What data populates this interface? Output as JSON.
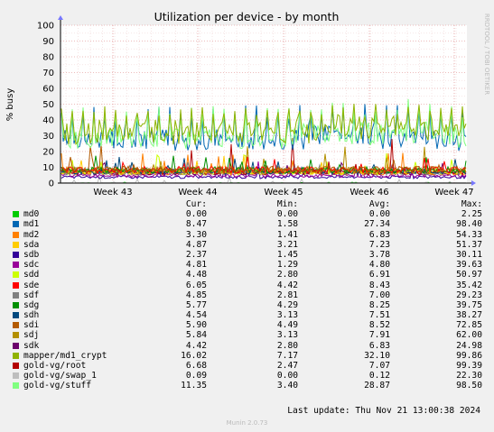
{
  "chart_data": {
    "type": "line",
    "title": "Utilization per device - by month",
    "ylabel": "% busy",
    "side_label": "RRDTOOL / TOBI OETIKER",
    "ylim": [
      0,
      100
    ],
    "y_ticks": [
      0,
      10,
      20,
      30,
      40,
      50,
      60,
      70,
      80,
      90,
      100
    ],
    "x_tick_labels": [
      "Week 43",
      "Week 44",
      "Week 45",
      "Week 46",
      "Week 47"
    ],
    "grid": true,
    "columns": {
      "cur": "Cur:",
      "min": "Min:",
      "avg": "Avg:",
      "max": "Max:"
    },
    "series": [
      {
        "name": "md0",
        "color": "#00cc00",
        "cur": "0.00",
        "min": "0.00",
        "avg": "0.00",
        "max": "2.25"
      },
      {
        "name": "md1",
        "color": "#0066b3",
        "cur": "8.47",
        "min": "1.58",
        "avg": "27.34",
        "max": "98.40"
      },
      {
        "name": "md2",
        "color": "#ff8000",
        "cur": "3.30",
        "min": "1.41",
        "avg": "6.83",
        "max": "54.33"
      },
      {
        "name": "sda",
        "color": "#ffcc00",
        "cur": "4.87",
        "min": "3.21",
        "avg": "7.23",
        "max": "51.37"
      },
      {
        "name": "sdb",
        "color": "#330099",
        "cur": "2.37",
        "min": "1.45",
        "avg": "3.78",
        "max": "30.11"
      },
      {
        "name": "sdc",
        "color": "#990099",
        "cur": "4.81",
        "min": "1.29",
        "avg": "4.80",
        "max": "39.63"
      },
      {
        "name": "sdd",
        "color": "#ccff00",
        "cur": "4.48",
        "min": "2.80",
        "avg": "6.91",
        "max": "50.97"
      },
      {
        "name": "sde",
        "color": "#ff0000",
        "cur": "6.05",
        "min": "4.42",
        "avg": "8.43",
        "max": "35.42"
      },
      {
        "name": "sdf",
        "color": "#808080",
        "cur": "4.85",
        "min": "2.81",
        "avg": "7.00",
        "max": "29.23"
      },
      {
        "name": "sdg",
        "color": "#008f00",
        "cur": "5.77",
        "min": "4.29",
        "avg": "8.25",
        "max": "39.75"
      },
      {
        "name": "sdh",
        "color": "#00487d",
        "cur": "4.54",
        "min": "3.13",
        "avg": "7.51",
        "max": "38.27"
      },
      {
        "name": "sdi",
        "color": "#b35a00",
        "cur": "5.90",
        "min": "4.49",
        "avg": "8.52",
        "max": "72.85"
      },
      {
        "name": "sdj",
        "color": "#b38f00",
        "cur": "5.84",
        "min": "3.13",
        "avg": "7.91",
        "max": "62.00"
      },
      {
        "name": "sdk",
        "color": "#6b006b",
        "cur": "4.42",
        "min": "2.80",
        "avg": "6.83",
        "max": "24.98"
      },
      {
        "name": "mapper/md1_crypt",
        "color": "#8fb300",
        "cur": "16.02",
        "min": "7.17",
        "avg": "32.10",
        "max": "99.86"
      },
      {
        "name": "gold-vg/root",
        "color": "#b30000",
        "cur": "6.68",
        "min": "2.47",
        "avg": "7.07",
        "max": "99.39"
      },
      {
        "name": "gold-vg/swap_1",
        "color": "#bebebe",
        "cur": "0.09",
        "min": "0.00",
        "avg": "0.12",
        "max": "22.30"
      },
      {
        "name": "gold-vg/stuff",
        "color": "#80ff80",
        "cur": "11.35",
        "min": "3.40",
        "avg": "28.87",
        "max": "98.50"
      }
    ]
  },
  "footer": {
    "last_update": "Last update: Thu Nov 21 13:00:38 2024",
    "munin_version": "Munin 2.0.73"
  }
}
